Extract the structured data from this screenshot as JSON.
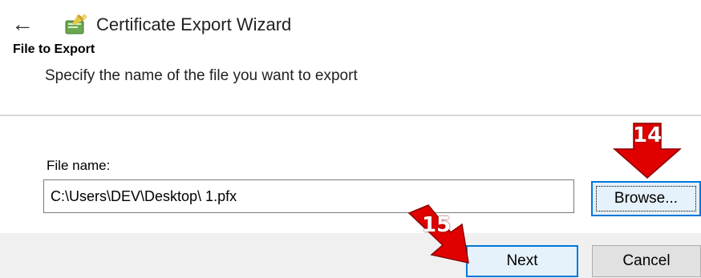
{
  "window": {
    "title": "Certificate Export Wizard",
    "back_icon": "back-arrow-icon",
    "app_icon": "certificate-wizard-icon"
  },
  "page": {
    "heading": "File to Export",
    "description": "Specify the name of the file you want to export"
  },
  "file_field": {
    "label": "File name:",
    "value": "C:\\Users\\DEV\\Desktop\\ 1.pfx"
  },
  "buttons": {
    "browse": "Browse...",
    "next": "Next",
    "cancel": "Cancel"
  },
  "callouts": {
    "browse_step": "14",
    "next_step": "15",
    "color": "#e00000"
  }
}
